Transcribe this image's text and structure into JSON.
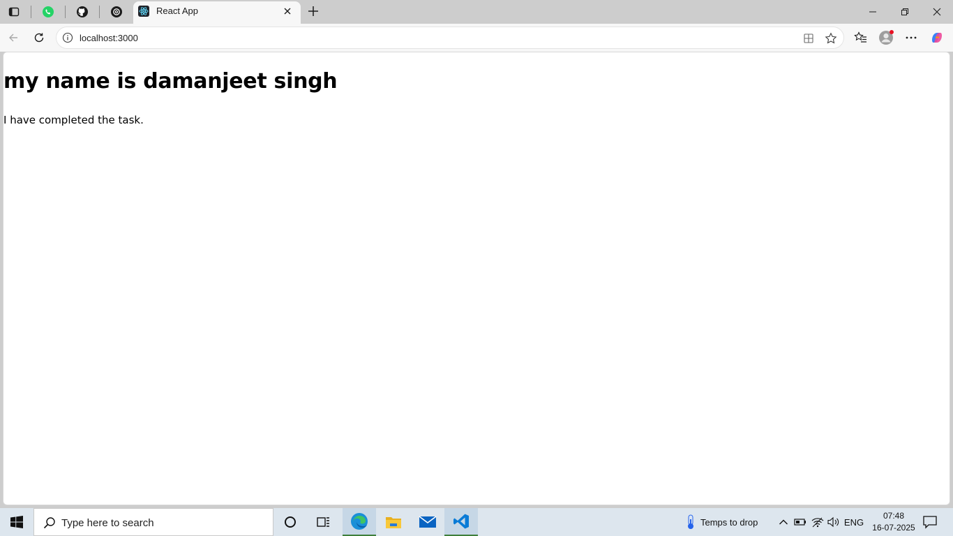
{
  "browser": {
    "active_tab": {
      "title": "React App",
      "favicon": "react-icon"
    },
    "pinned_tabs": [
      "whatsapp-icon",
      "github-icon",
      "openai-icon"
    ],
    "url": "localhost:3000"
  },
  "page": {
    "heading": "my name is damanjeet singh",
    "text": "I have completed the task."
  },
  "taskbar": {
    "search_placeholder": "Type here to search",
    "weather_text": "Temps to drop",
    "language": "ENG",
    "time": "07:48",
    "date": "16-07-2025",
    "apps": [
      "cortana-icon",
      "task-view-icon",
      "edge-icon",
      "file-explorer-icon",
      "mail-icon",
      "vscode-icon"
    ]
  },
  "colors": {
    "tabstrip_bg": "#cdcdcd",
    "toolbar_bg": "#f7f7f7",
    "taskbar_bg": "#dde6ee",
    "whatsapp": "#25d366",
    "vscode": "#0a7bd6",
    "edge": "#1a8fd8",
    "running_indicator": "#3e7f3a"
  }
}
